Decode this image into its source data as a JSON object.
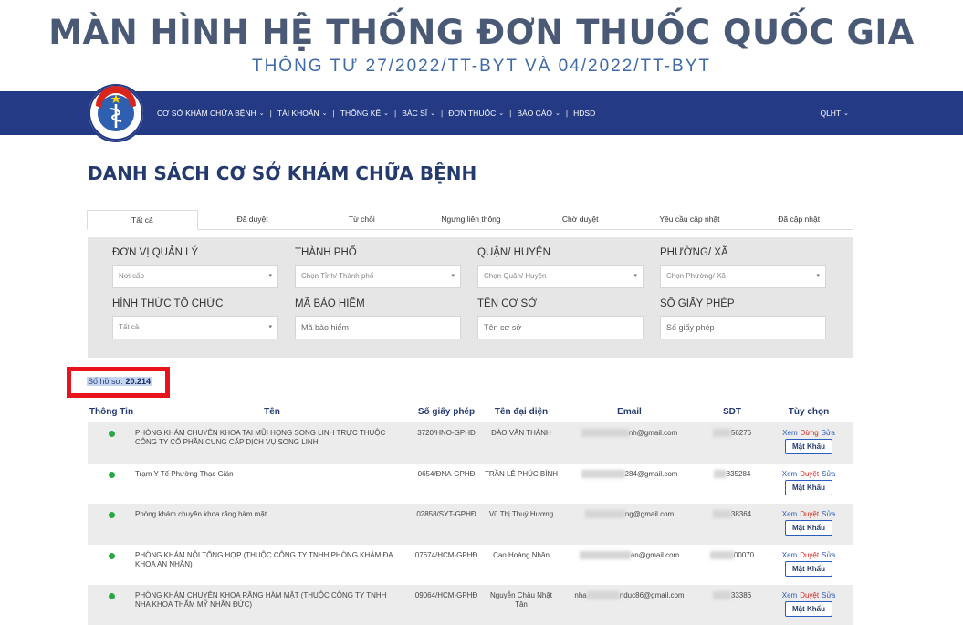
{
  "banner": {
    "title": "MÀN HÌNH HỆ THỐNG ĐƠN THUỐC QUỐC GIA",
    "subtitle": "THÔNG TƯ 27/2022/TT-BYT VÀ 04/2022/TT-BYT"
  },
  "logo": {
    "top_text": "BỘ Y TẾ",
    "bottom_text": "MINISTRY OF HEALTH"
  },
  "nav": {
    "items": [
      {
        "label": "CƠ SỞ KHÁM CHỮA BỆNH"
      },
      {
        "label": "TÀI KHOẢN"
      },
      {
        "label": "THỐNG KÊ"
      },
      {
        "label": "BÁC SĨ"
      },
      {
        "label": "ĐƠN THUỐC"
      },
      {
        "label": "BÁO CÁO"
      },
      {
        "label": "HDSD"
      }
    ],
    "user": "QLHT"
  },
  "page_title": "DANH SÁCH CƠ SỞ KHÁM CHỮA BỆNH",
  "tabs": [
    "Tất cả",
    "Đã duyệt",
    "Từ chối",
    "Ngưng liên thông",
    "Chờ duyệt",
    "Yêu cầu cập nhật",
    "Đã cập nhật"
  ],
  "filters": {
    "don_vi": {
      "label": "ĐƠN VỊ QUẢN LÝ",
      "value": "Nơi cấp"
    },
    "thanh_pho": {
      "label": "THÀNH PHỐ",
      "value": "Chọn Tỉnh/ Thành phố"
    },
    "quan": {
      "label": "QUẬN/ HUYỆN",
      "value": "Chọn Quận/ Huyện"
    },
    "phuong": {
      "label": "PHƯỜNG/ XÃ",
      "value": "Chọn Phường/ Xã"
    },
    "hinh_thuc": {
      "label": "HÌNH THỨC TỔ CHỨC",
      "value": "Tất cả"
    },
    "ma_bh": {
      "label": "MÃ BẢO HIỂM",
      "placeholder": "Mã bảo hiểm"
    },
    "ten_co_so": {
      "label": "TÊN CƠ SỞ",
      "placeholder": "Tên cơ sở"
    },
    "so_giay_phep": {
      "label": "SỐ GIẤY PHÉP",
      "placeholder": "Số giấy phép"
    }
  },
  "count": {
    "label": "Số hồ sơ:",
    "value": "20.214"
  },
  "table": {
    "headers": {
      "status": "Thông Tin",
      "name": "Tên",
      "license": "Số giấy phép",
      "rep": "Tên đại diện",
      "email": "Email",
      "phone": "SDT",
      "action": "Tùy chọn"
    },
    "rows": [
      {
        "name": "PHÒNG KHÁM CHUYÊN KHOA TAI MŨI HỌNG SONG LINH TRỰC THUỘC CÔNG TY CỔ PHẦN CUNG CẤP DỊCH VỤ SONG LINH",
        "license": "3720/HNO-GPHĐ",
        "rep": "ĐÀO VĂN THÀNH",
        "email_prefix": "",
        "email": "nh@gmail.com",
        "phone": "56276",
        "link_view": "Xem",
        "link_action": "Dừng",
        "link_edit": "Sửa",
        "btn": "Mật Khẩu"
      },
      {
        "name": "Trạm Y Tế Phường Thạc Gián",
        "license": "0654/ĐNA-GPHĐ",
        "rep": "TRẦN LÊ PHÚC BÌNH",
        "email_prefix": "",
        "email": "284@gmail.com",
        "phone": "835284",
        "link_view": "Xem",
        "link_action": "Duyệt",
        "link_edit": "Sửa",
        "btn": "Mật Khẩu"
      },
      {
        "name": "Phòng khám chuyên khoa răng hàm mặt",
        "license": "02858/SYT-GPHĐ",
        "rep": "Vũ Thị Thuý Hương",
        "email_prefix": "",
        "email": "ng@gmail.com",
        "phone": "38364",
        "link_view": "Xem",
        "link_action": "Duyệt",
        "link_edit": "Sửa",
        "btn": "Mật Khẩu"
      },
      {
        "name": "PHÒNG KHÁM NỘI TỔNG HỢP (THUỘC CÔNG TY TNHH PHÒNG KHÁM ĐA KHOA AN NHÂN)",
        "license": "07674/HCM-GPHĐ",
        "rep": "Cao Hoàng Nhân",
        "email_prefix": "",
        "email": "an@gmail.com",
        "phone": "00070",
        "link_view": "Xem",
        "link_action": "Duyệt",
        "link_edit": "Sửa",
        "btn": "Mật Khẩu"
      },
      {
        "name": "PHÒNG KHÁM CHUYÊN KHOA RĂNG HÀM MẶT (THUỘC CÔNG TY TNHH NHA KHOA THẨM MỸ NHÂN ĐỨC)",
        "license": "09064/HCM-GPHĐ",
        "rep": "Nguyễn Châu Nhật Tân",
        "email_prefix": "nha",
        "email": "nduc86@gmail.com",
        "phone": "33386",
        "link_view": "Xem",
        "link_action": "Duyệt",
        "link_edit": "Sửa",
        "btn": "Mật Khẩu"
      }
    ]
  },
  "colors": {
    "navbar": "#243a84",
    "title": "#243a6e",
    "status_dot": "#28a745",
    "highlight_box": "#e8141b"
  }
}
